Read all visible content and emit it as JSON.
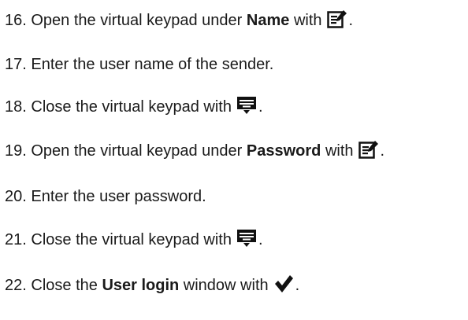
{
  "steps": [
    {
      "num": "16.",
      "pre": "Open the virtual keypad under",
      "bold": "Name",
      "post": "with",
      "icon": "edit-icon",
      "end": "."
    },
    {
      "num": "17.",
      "pre": "Enter the user name of the sender.",
      "bold": "",
      "post": "",
      "icon": "",
      "end": ""
    },
    {
      "num": "18.",
      "pre": "Close the virtual keypad with",
      "bold": "",
      "post": "",
      "icon": "keyboard-close-icon",
      "end": "."
    },
    {
      "num": "19.",
      "pre": "Open the virtual keypad under",
      "bold": "Password",
      "post": "with",
      "icon": "edit-icon",
      "end": "."
    },
    {
      "num": "20.",
      "pre": "Enter the user password.",
      "bold": "",
      "post": "",
      "icon": "",
      "end": ""
    },
    {
      "num": "21.",
      "pre": "Close the virtual keypad with",
      "bold": "",
      "post": "",
      "icon": "keyboard-close-icon",
      "end": "."
    },
    {
      "num": "22.",
      "pre": "Close the",
      "bold": "User login",
      "post": "window with",
      "icon": "checkmark-icon",
      "end": "."
    }
  ]
}
